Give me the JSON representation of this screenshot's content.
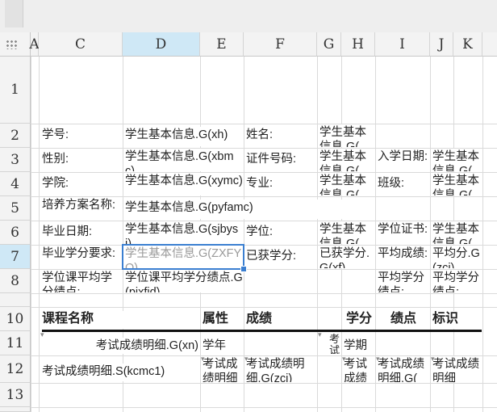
{
  "column_headers": [
    "A",
    "C",
    "D",
    "E",
    "F",
    "G",
    "H",
    "I",
    "J",
    "K"
  ],
  "row_headers": [
    "1",
    "2",
    "3",
    "4",
    "5",
    "6",
    "7",
    "8",
    "10",
    "11",
    "12",
    "13"
  ],
  "active_cell": {
    "column": "D",
    "row": "7"
  },
  "cells": {
    "r2_label": "学号:",
    "r2_value": "学生基本信息.G(xh)",
    "r2_label2": "姓名:",
    "r2_value2": "学生基本信息.G(",
    "r3_label": "性别:",
    "r3_value": "学生基本信息.G(xbmc)",
    "r3_label2": "证件号码:",
    "r3_value2": "学生基本信息.G(",
    "r3_label3": "入学日期:",
    "r3_value3": "学生基本信息.G(",
    "r4_label": "学院:",
    "r4_value": "学生基本信息.G(xymc)",
    "r4_label2": "专业:",
    "r4_value2": "学生基本信息.G(",
    "r4_label3": "班级:",
    "r4_value3": "学生基本信息.G(",
    "r5_label": "培养方案名称:",
    "r5_value": "学生基本信息.G(pyfamc)",
    "r6_label": "毕业日期:",
    "r6_value": "学生基本信息.G(sjbysj)",
    "r6_label2": "学位:",
    "r6_value2": "学生基本信息.G(",
    "r6_label3": "学位证书:",
    "r6_value3": "学生基本信息.G(",
    "r7_label": "毕业学分要求:",
    "r7_value": "学生基本信息.G(ZXFYQ)",
    "r7_label2": "已获学分:",
    "r7_value2": "已获学分.G(xf)",
    "r7_label3": "平均成绩:",
    "r7_value3": "平均分.G(zcj)",
    "r8_label": "学位课平均学分绩点:",
    "r8_value": "学位课平均学分绩点.G(pjxfjd)",
    "r8_label3": "平均学分绩点:",
    "r8_value3": "平均学分绩点:",
    "r10_course": "课程名称",
    "r10_attr": "属性",
    "r10_score": "成绩",
    "r10_credit": "学分",
    "r10_gpa": "绩点",
    "r10_flag": "标识",
    "r11_course": "考试成绩明细.G(xn)",
    "r11_year": "学年",
    "r11_exam": "考试",
    "r11_term": "学期",
    "r12_course": "考试成绩明细.S(kcmc1)",
    "r12_attr": "考试成绩明细",
    "r12_score": "考试成绩明细.G(zcj)",
    "r12_credit": "考试成绩",
    "r12_gpa": "考试成绩明细.G(",
    "r12_flag": "考试成绩明细"
  }
}
